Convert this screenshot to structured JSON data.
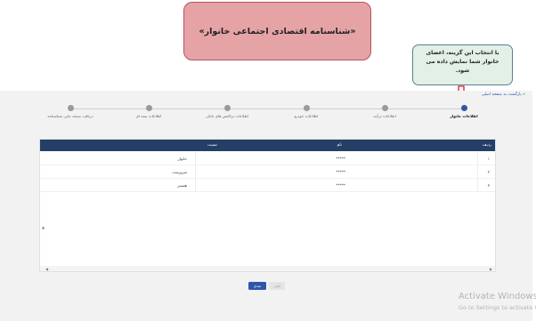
{
  "banner": {
    "title": "«شناسنامه اقتصادی اجتماعی خانوار»"
  },
  "tooltip": {
    "line1": "با انتخاب این گزینه، اعضای",
    "line2": "خانوار شما نمایش داده می شود."
  },
  "nav": {
    "back_link": "« بازگشت به صفحه اصلی"
  },
  "stepper": {
    "steps": [
      {
        "label": "اطلاعات خانوار",
        "active": true
      },
      {
        "label": "اطلاعات درآمد",
        "active": false
      },
      {
        "label": "اطلاعات خودرو",
        "active": false
      },
      {
        "label": "اطلاعات تراکنش های بانکی",
        "active": false
      },
      {
        "label": "اطلاعات بیمه ای",
        "active": false
      },
      {
        "label": "دریافت نسخه چاپی شناسنامه",
        "active": false
      }
    ]
  },
  "table": {
    "headers": {
      "index": "ردیف",
      "name": "نام",
      "relation": "نسبت"
    },
    "rows": [
      {
        "index": "۱",
        "name": "*****",
        "relation": "خانوار"
      },
      {
        "index": "۲",
        "name": "*****",
        "relation": "سرپرست"
      },
      {
        "index": "۳",
        "name": "*****",
        "relation": "همسر"
      }
    ]
  },
  "buttons": {
    "next": "بعدی",
    "prev": "قبلی"
  },
  "watermark": {
    "title": "Activate Windows",
    "subtitle": "Go to Settings to activate Windows."
  },
  "colors": {
    "accent": "#2f56a8",
    "header": "#243f66",
    "banner_bg": "#e6a3a6",
    "tooltip_bg": "#e3f0e6",
    "arrow": "#e02020"
  }
}
